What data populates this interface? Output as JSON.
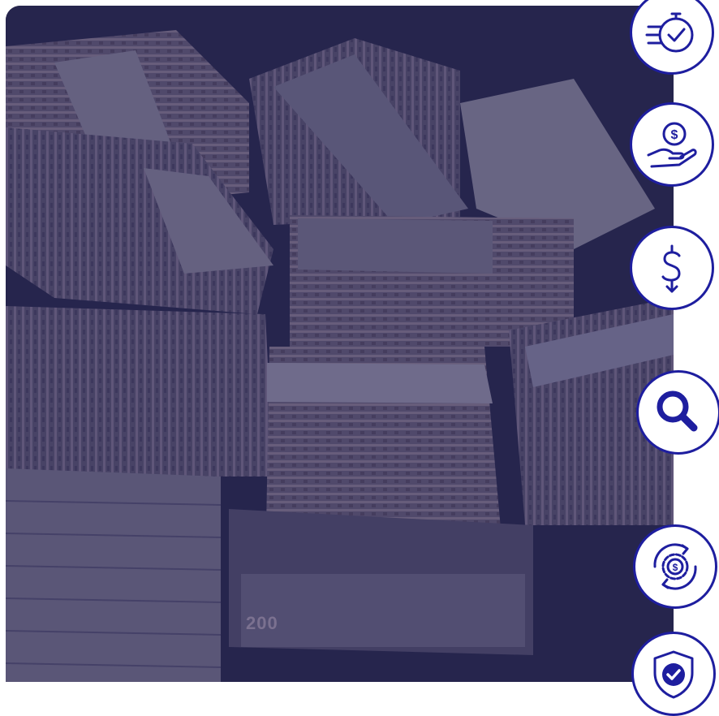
{
  "photo": {
    "subject": "stacks-of-banknotes",
    "overlay_color": "#1f1f5a",
    "visible_text": "200"
  },
  "features": [
    {
      "icon": "fast-clock-check-icon"
    },
    {
      "icon": "hand-dollar-icon"
    },
    {
      "icon": "dollar-down-icon"
    },
    {
      "icon": "search-icon"
    },
    {
      "icon": "gear-dollar-icon"
    },
    {
      "icon": "shield-check-icon"
    }
  ],
  "colors": {
    "accent": "#1e1e9f",
    "background": "#ffffff"
  }
}
